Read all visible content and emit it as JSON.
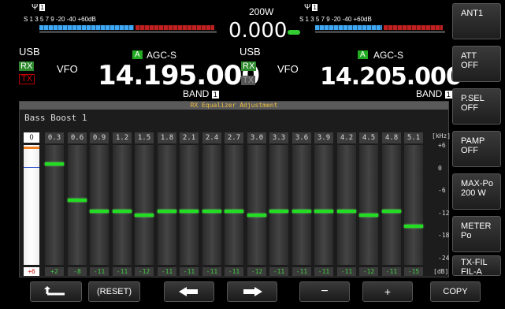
{
  "meters": {
    "left_scale": "S 1  3  5  7  9   -20  -40 +60dB",
    "right_scale": "S 1  3  5  7  9   -20  -40 +60dB",
    "ant_left": "1",
    "ant_right": "1"
  },
  "power": {
    "label": "200W",
    "value": "0.000"
  },
  "left": {
    "mode": "USB",
    "rx": "RX",
    "tx": "TX",
    "vfo": "VFO",
    "agc_badge": "A",
    "agc": "AGC-S",
    "freq": "14.195.000",
    "band": "BAND",
    "band_num": "1"
  },
  "right": {
    "mode": "USB",
    "rx": "RX",
    "tx": "TX",
    "vfo": "VFO",
    "agc_badge": "A",
    "agc": "AGC-S",
    "freq": "14.205.000",
    "band": "BAND",
    "band_num": "1"
  },
  "equalizer": {
    "title": "RX Equalizer Adjustment",
    "preset": "Bass Boost 1",
    "first_label": "0",
    "first_value": "+6",
    "unit_top": "[kHz]",
    "unit_bottom": "[dB]",
    "scale": [
      "+6",
      "0",
      "-6",
      "-12",
      "-18",
      "-24"
    ],
    "bands": [
      {
        "freq": "0.3",
        "level": 2,
        "label": "+2"
      },
      {
        "freq": "0.6",
        "level": -8,
        "label": "-8"
      },
      {
        "freq": "0.9",
        "level": -11,
        "label": "-11"
      },
      {
        "freq": "1.2",
        "level": -11,
        "label": "-11"
      },
      {
        "freq": "1.5",
        "level": -12,
        "label": "-12"
      },
      {
        "freq": "1.8",
        "level": -11,
        "label": "-11"
      },
      {
        "freq": "2.1",
        "level": -11,
        "label": "-11"
      },
      {
        "freq": "2.4",
        "level": -11,
        "label": "-11"
      },
      {
        "freq": "2.7",
        "level": -11,
        "label": "-11"
      },
      {
        "freq": "3.0",
        "level": -12,
        "label": "-12"
      },
      {
        "freq": "3.3",
        "level": -11,
        "label": "-11"
      },
      {
        "freq": "3.6",
        "level": -11,
        "label": "-11"
      },
      {
        "freq": "3.9",
        "level": -11,
        "label": "-11"
      },
      {
        "freq": "4.2",
        "level": -11,
        "label": "-11"
      },
      {
        "freq": "4.5",
        "level": -12,
        "label": "-12"
      },
      {
        "freq": "4.8",
        "level": -11,
        "label": "-11"
      },
      {
        "freq": "5.1",
        "level": -15,
        "label": "-15"
      }
    ]
  },
  "softkeys": [
    {
      "l1": "ANT1",
      "l2": ""
    },
    {
      "l1": "ATT",
      "l2": "OFF"
    },
    {
      "l1": "P.SEL",
      "l2": "OFF"
    },
    {
      "l1": "PAMP",
      "l2": "OFF"
    },
    {
      "l1": "MAX-Po",
      "l2": "200 W"
    },
    {
      "l1": "METER",
      "l2": "Po"
    },
    {
      "l1": "TX-FIL",
      "l2": "FIL-A"
    }
  ],
  "bottom": {
    "reset": "(RESET)",
    "minus": "−",
    "plus": "+",
    "copy": "COPY"
  },
  "colors": {
    "level": "#22dd22",
    "rx": "#2d8a2d",
    "tx": "#dd0000",
    "meter_blue": "#3fa9f5",
    "meter_red": "#c02020"
  }
}
